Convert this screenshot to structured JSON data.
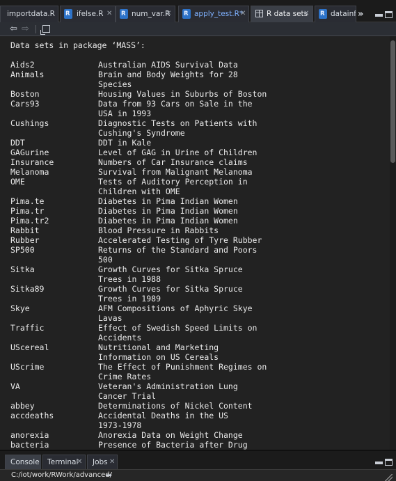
{
  "tabs": [
    {
      "label": "importdata.R",
      "has_close": false,
      "modified": false,
      "active": false,
      "icon": "none"
    },
    {
      "label": "ifelse.R",
      "has_close": true,
      "modified": false,
      "active": false,
      "icon": "r-file-icon"
    },
    {
      "label": "num_var.R",
      "has_close": true,
      "modified": false,
      "active": false,
      "icon": "r-file-icon"
    },
    {
      "label": "apply_test.R*",
      "has_close": true,
      "modified": true,
      "active": false,
      "icon": "r-file-icon"
    },
    {
      "label": "R data sets",
      "has_close": true,
      "modified": false,
      "active": true,
      "icon": "table-icon"
    },
    {
      "label": "datainfo.",
      "has_close": false,
      "modified": false,
      "active": false,
      "icon": "r-file-icon"
    }
  ],
  "tab_overflow_glyph": "»",
  "toolbar": {
    "back_glyph": "⇦",
    "forward_glyph": "⇨"
  },
  "content": {
    "heading": "Data sets in package ‘MASS’:",
    "datasets": [
      {
        "name": "Aids2",
        "desc": "Australian AIDS Survival Data"
      },
      {
        "name": "Animals",
        "desc": "Brain and Body Weights for 28\nSpecies"
      },
      {
        "name": "Boston",
        "desc": "Housing Values in Suburbs of Boston"
      },
      {
        "name": "Cars93",
        "desc": "Data from 93 Cars on Sale in the\nUSA in 1993"
      },
      {
        "name": "Cushings",
        "desc": "Diagnostic Tests on Patients with\nCushing's Syndrome"
      },
      {
        "name": "DDT",
        "desc": "DDT in Kale"
      },
      {
        "name": "GAGurine",
        "desc": "Level of GAG in Urine of Children"
      },
      {
        "name": "Insurance",
        "desc": "Numbers of Car Insurance claims"
      },
      {
        "name": "Melanoma",
        "desc": "Survival from Malignant Melanoma"
      },
      {
        "name": "OME",
        "desc": "Tests of Auditory Perception in\nChildren with OME"
      },
      {
        "name": "Pima.te",
        "desc": "Diabetes in Pima Indian Women"
      },
      {
        "name": "Pima.tr",
        "desc": "Diabetes in Pima Indian Women"
      },
      {
        "name": "Pima.tr2",
        "desc": "Diabetes in Pima Indian Women"
      },
      {
        "name": "Rabbit",
        "desc": "Blood Pressure in Rabbits"
      },
      {
        "name": "Rubber",
        "desc": "Accelerated Testing of Tyre Rubber"
      },
      {
        "name": "SP500",
        "desc": "Returns of the Standard and Poors\n500"
      },
      {
        "name": "Sitka",
        "desc": "Growth Curves for Sitka Spruce\nTrees in 1988"
      },
      {
        "name": "Sitka89",
        "desc": "Growth Curves for Sitka Spruce\nTrees in 1989"
      },
      {
        "name": "Skye",
        "desc": "AFM Compositions of Aphyric Skye\nLavas"
      },
      {
        "name": "Traffic",
        "desc": "Effect of Swedish Speed Limits on\nAccidents"
      },
      {
        "name": "UScereal",
        "desc": "Nutritional and Marketing\nInformation on US Cereals"
      },
      {
        "name": "UScrime",
        "desc": "The Effect of Punishment Regimes on\nCrime Rates"
      },
      {
        "name": "VA",
        "desc": "Veteran's Administration Lung\nCancer Trial"
      },
      {
        "name": "abbey",
        "desc": "Determinations of Nickel Content"
      },
      {
        "name": "accdeaths",
        "desc": "Accidental Deaths in the US\n1973-1978"
      },
      {
        "name": "anorexia",
        "desc": "Anorexia Data on Weight Change"
      },
      {
        "name": "bacteria",
        "desc": "Presence of Bacteria after Drug"
      }
    ]
  },
  "bottom_tabs": [
    {
      "label": "Console",
      "active": true
    },
    {
      "label": "Terminal",
      "active": false
    },
    {
      "label": "Jobs",
      "active": false
    }
  ],
  "console": {
    "working_dir": "C:/iot/work/RWork/advanced/",
    "goto_glyph": "➦"
  },
  "colors": {
    "background": "#222222",
    "text": "#eaeaea",
    "modified_tab_text": "#7fb1ff",
    "r_icon": "#2d73c9"
  }
}
